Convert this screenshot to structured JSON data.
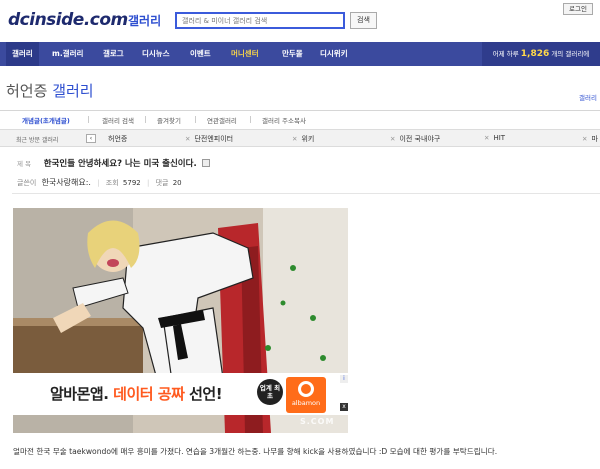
{
  "header": {
    "logo": "dcinside.com",
    "logo_sub": "갤러리",
    "search_placeholder": "갤러리 & 미이너 갤러리 검색",
    "search_label": "검색",
    "login_label": "로그인"
  },
  "nav": {
    "items": [
      {
        "label": "갤러리"
      },
      {
        "label": "m.갤러리"
      },
      {
        "label": "갤로그"
      },
      {
        "label": "디시뉴스"
      },
      {
        "label": "이벤트"
      },
      {
        "label": "머니센터"
      },
      {
        "label": "만두몰"
      },
      {
        "label": "디시위키"
      }
    ],
    "visitor_prefix": "어제 하루",
    "visitor_count": "1,826",
    "visitor_suffix": "개의 갤러리에"
  },
  "gallery": {
    "title_main": "허언증",
    "title_accent": "갤러리",
    "side_link": "갤러리"
  },
  "tabs": [
    {
      "label": "개념글(초개념글)"
    },
    {
      "label": "갤러리 검색"
    },
    {
      "label": "즐겨찾기"
    },
    {
      "label": "연관갤러리"
    },
    {
      "label": "갤러리 주소복사"
    }
  ],
  "recent": {
    "label": "최근 방문 갤러리",
    "prev_icon": "‹",
    "items": [
      {
        "label": "허언증"
      },
      {
        "label": "단전엔피이터"
      },
      {
        "label": "위키"
      },
      {
        "label": "이전 국내야구"
      },
      {
        "label": "HIT"
      },
      {
        "label": "마"
      }
    ]
  },
  "post": {
    "subject_label": "제 목",
    "title": "한국인들 안녕하세요? 나는 미국 출신이다.",
    "author_label": "글쓴이",
    "author": "한국사랑해요:.",
    "views_label": "조회",
    "views": "5792",
    "comments_label": "댓글",
    "comments": "20",
    "body": "얼마전 한국 무술 taekwondo에 매우 흥미를 가졌다. 연습을 3개월간 하는중. 나무를 향해 kick을 사용하였습니다 :D 모습에 대한 평가를 부탁드립니다."
  },
  "ad": {
    "text_black": "알바몬앱.",
    "text_orange": "데이터 공짜",
    "text_end": "선언!",
    "badge": "업계 최초",
    "logo_label": "albamon",
    "info": "i",
    "close": "x"
  },
  "watermark": "S.COM",
  "colors": {
    "nav_bg": "#3b4a9e",
    "accent": "#2e4fd0",
    "highlight": "#f6d44a",
    "ad_orange": "#ff5a1f"
  }
}
